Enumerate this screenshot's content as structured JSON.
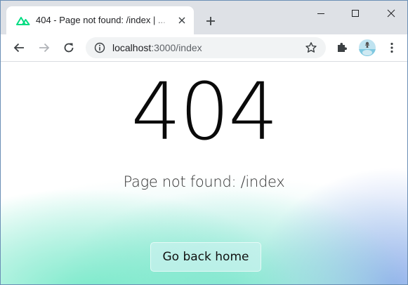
{
  "tab": {
    "title": "404 - Page not found: /index | ...",
    "logo_color": "#00dc82"
  },
  "address_bar": {
    "host": "localhost",
    "rest": ":3000/index"
  },
  "page": {
    "status_code": "404",
    "message": "Page not found: /index",
    "home_button": "Go back home"
  },
  "colors": {
    "tabstrip": "#dee1e6",
    "omnibox": "#f1f3f4",
    "accent_teal": "#6ce8c4",
    "accent_blue": "#8caaeb"
  }
}
